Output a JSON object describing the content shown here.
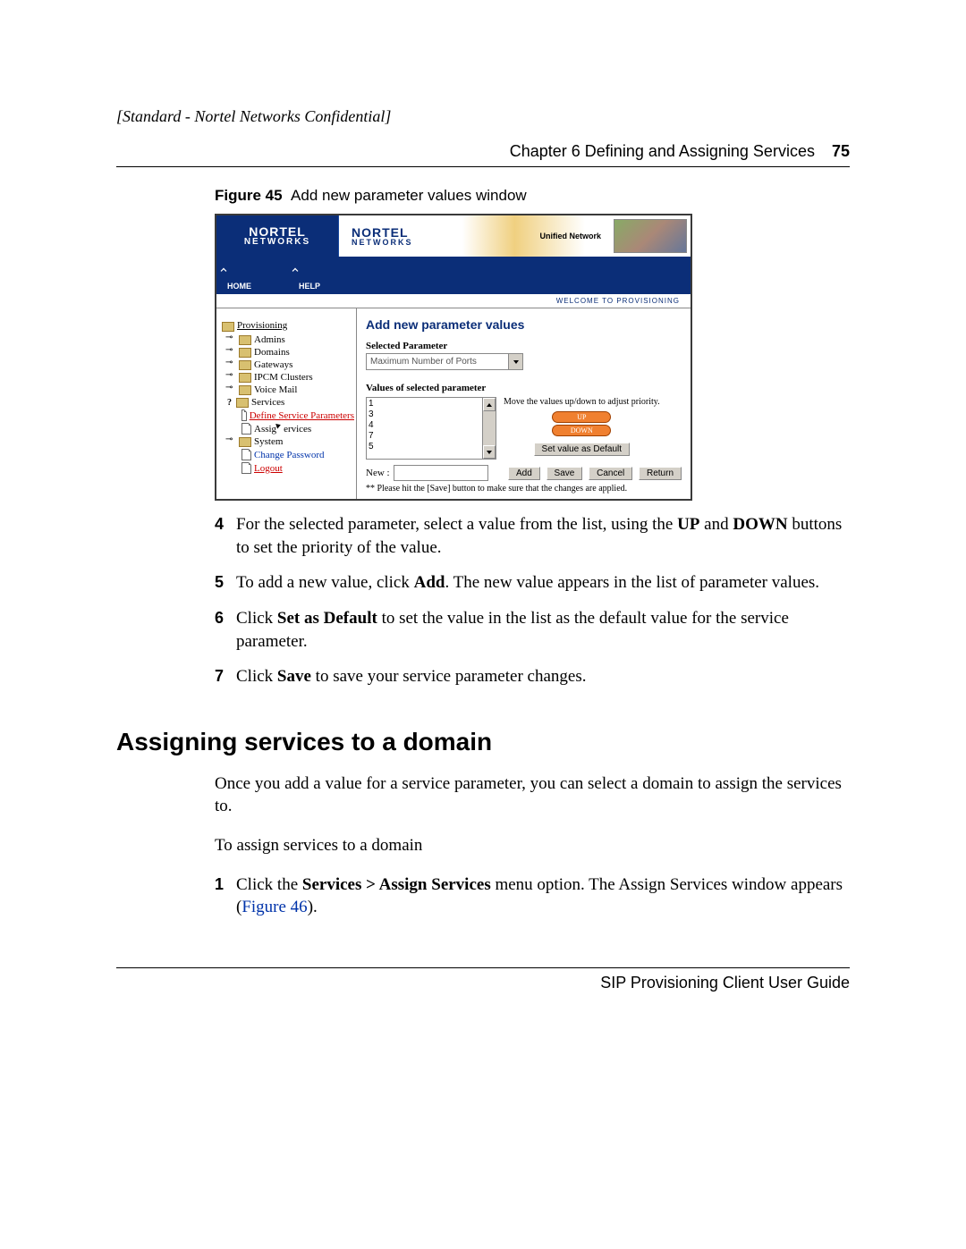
{
  "header": {
    "confidential": "[Standard - Nortel Networks Confidential]",
    "chapter_line": "Chapter 6  Defining and Assigning Services",
    "page_number": "75"
  },
  "figure": {
    "label": "Figure 45",
    "caption": "Add new parameter values window"
  },
  "screenshot": {
    "logo_line1": "NORTEL",
    "logo_line2": "NETWORKS",
    "unified": "Unified Network",
    "nav": {
      "home": "HOME",
      "help": "HELP"
    },
    "welcome": "WELCOME TO PROVISIONING",
    "sidebar": {
      "root": "Provisioning",
      "items": [
        "Admins",
        "Domains",
        "Gateways",
        "IPCM Clusters",
        "Voice Mail"
      ],
      "services": "Services",
      "services_children": {
        "define": "Define Service Parameters",
        "assign": "Assign Services"
      },
      "system": "System",
      "system_children": {
        "change_pw": "Change Password",
        "logout": "Logout"
      }
    },
    "main": {
      "title": "Add new parameter values",
      "selected_label": "Selected Parameter",
      "selected_value": "Maximum Number of Ports",
      "values_label": "Values of selected parameter",
      "values": [
        "1",
        "3",
        "4",
        "7",
        "5"
      ],
      "hint": "Move the values up/down to adjust priority.",
      "up_btn": "UP",
      "down_btn": "DOWN",
      "default_btn": "Set value as Default",
      "new_label": "New :",
      "add_btn": "Add",
      "save_btn": "Save",
      "cancel_btn": "Cancel",
      "return_btn": "Return",
      "note": "** Please hit the [Save] button to make sure that the changes are applied."
    }
  },
  "steps_a": {
    "s4_pre": "For the selected parameter, select a value from the list, using the ",
    "s4_b1": "UP",
    "s4_mid": " and ",
    "s4_b2": "DOWN",
    "s4_post": " buttons to set the priority of the value.",
    "s5_pre": "To add a new value, click ",
    "s5_b": "Add",
    "s5_post": ". The new value appears in the list of parameter values.",
    "s6_pre": "Click ",
    "s6_b": "Set as Default",
    "s6_post": " to set the value in the list as the default value for the service parameter.",
    "s7_pre": "Click ",
    "s7_b": "Save",
    "s7_post": " to save your service parameter changes."
  },
  "section_heading": "Assigning services to a domain",
  "para1": "Once you add a value for a service parameter, you can select a domain to assign the services to.",
  "para2": "To assign services to a domain",
  "steps_b": {
    "s1_pre": "Click the ",
    "s1_b": "Services > Assign Services",
    "s1_mid": " menu option. The Assign Services window appears (",
    "s1_link": "Figure 46",
    "s1_post": ")."
  },
  "footer": "SIP Provisioning Client User Guide"
}
